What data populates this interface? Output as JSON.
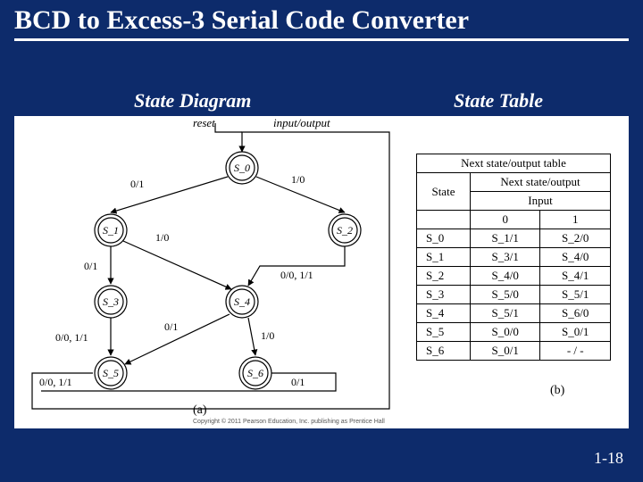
{
  "title": "BCD to Excess-3 Serial Code Converter",
  "subtitles": {
    "diagram": "State Diagram",
    "table": "State Table"
  },
  "footer": "1-18",
  "panel_labels": {
    "a": "(a)",
    "b": "(b)"
  },
  "copyright": "Copyright © 2011 Pearson Education, Inc. publishing as Prentice Hall",
  "diagram": {
    "top_labels": {
      "reset": "reset",
      "io": "input/output"
    },
    "states": [
      "S_0",
      "S_1",
      "S_2",
      "S_3",
      "S_4",
      "S_5",
      "S_6"
    ],
    "edges": {
      "s0_s1": "0/1",
      "s0_s2": "1/0",
      "s1_s3": "0/1",
      "s1_s4": "1/0",
      "s2_s4": "0/0, 1/1",
      "s3_s5": "0/0, 1/1",
      "s4_s5": "0/1",
      "s4_s6": "1/0",
      "s5_s0": "0/0, 1/1",
      "s6_s0": "0/1"
    }
  },
  "table": {
    "title": "Next state/output table",
    "sub": "Next state/output",
    "col_state": "State",
    "col_input": "Input",
    "inputs": [
      "0",
      "1"
    ],
    "rows": [
      {
        "s": "S_0",
        "c0": "S_1/1",
        "c1": "S_2/0"
      },
      {
        "s": "S_1",
        "c0": "S_3/1",
        "c1": "S_4/0"
      },
      {
        "s": "S_2",
        "c0": "S_4/0",
        "c1": "S_4/1"
      },
      {
        "s": "S_3",
        "c0": "S_5/0",
        "c1": "S_5/1"
      },
      {
        "s": "S_4",
        "c0": "S_5/1",
        "c1": "S_6/0"
      },
      {
        "s": "S_5",
        "c0": "S_0/0",
        "c1": "S_0/1"
      },
      {
        "s": "S_6",
        "c0": "S_0/1",
        "c1": "- / -"
      }
    ]
  }
}
